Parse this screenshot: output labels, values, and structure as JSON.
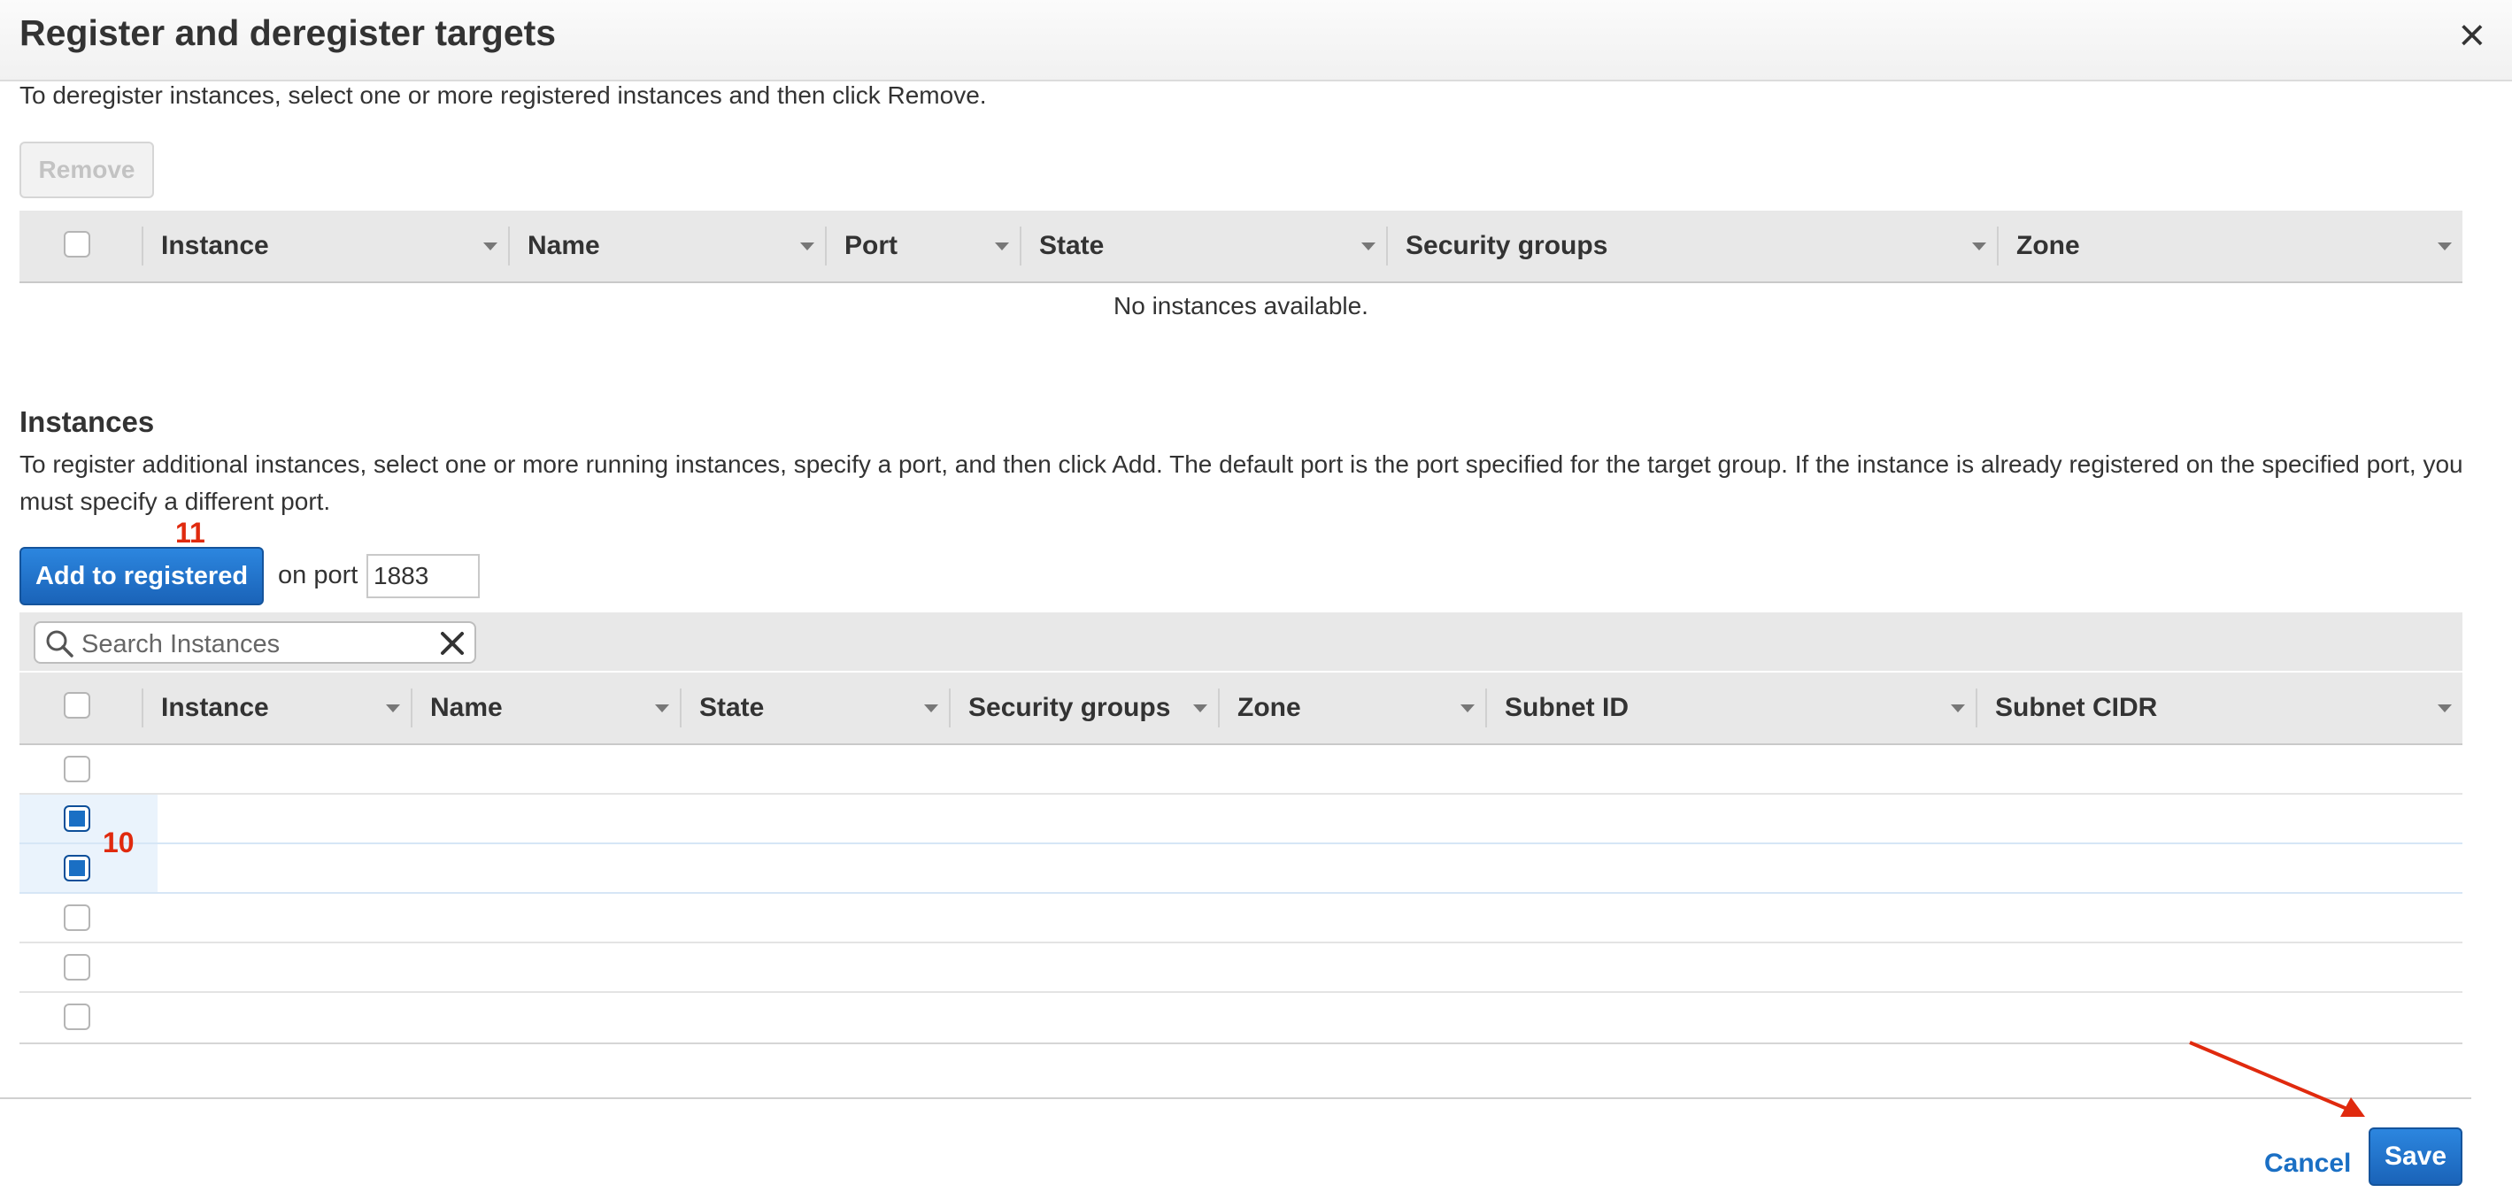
{
  "dialog": {
    "title": "Register and deregister targets",
    "close_glyph": "×"
  },
  "registered": {
    "instruction": "To deregister instances, select one or more registered instances and then click Remove.",
    "remove_label": "Remove",
    "columns": [
      "Instance",
      "Name",
      "Port",
      "State",
      "Security groups",
      "Zone"
    ],
    "empty_message": "No instances available."
  },
  "instances": {
    "section_title": "Instances",
    "description": "To register additional instances, select one or more running instances, specify a port, and then click Add. The default port is the port specified for the target group. If the instance is already registered on the specified port, you must specify a different port.",
    "add_label": "Add to registered",
    "on_port_label": "on port",
    "port_value": "1883",
    "search_placeholder": "Search Instances",
    "columns": [
      "Instance",
      "Name",
      "State",
      "Security groups",
      "Zone",
      "Subnet ID",
      "Subnet CIDR"
    ],
    "rows": [
      {
        "checked": false
      },
      {
        "checked": true
      },
      {
        "checked": true
      },
      {
        "checked": false
      },
      {
        "checked": false
      },
      {
        "checked": false
      }
    ]
  },
  "annotations": {
    "add_step": "11",
    "rows_step": "10",
    "color": "#e02a0e"
  },
  "footer": {
    "cancel_label": "Cancel",
    "save_label": "Save"
  },
  "colors": {
    "primary": "#1a6fc4",
    "header_bg": "#e8e8e8",
    "selected_row": "#eaf3fc"
  }
}
